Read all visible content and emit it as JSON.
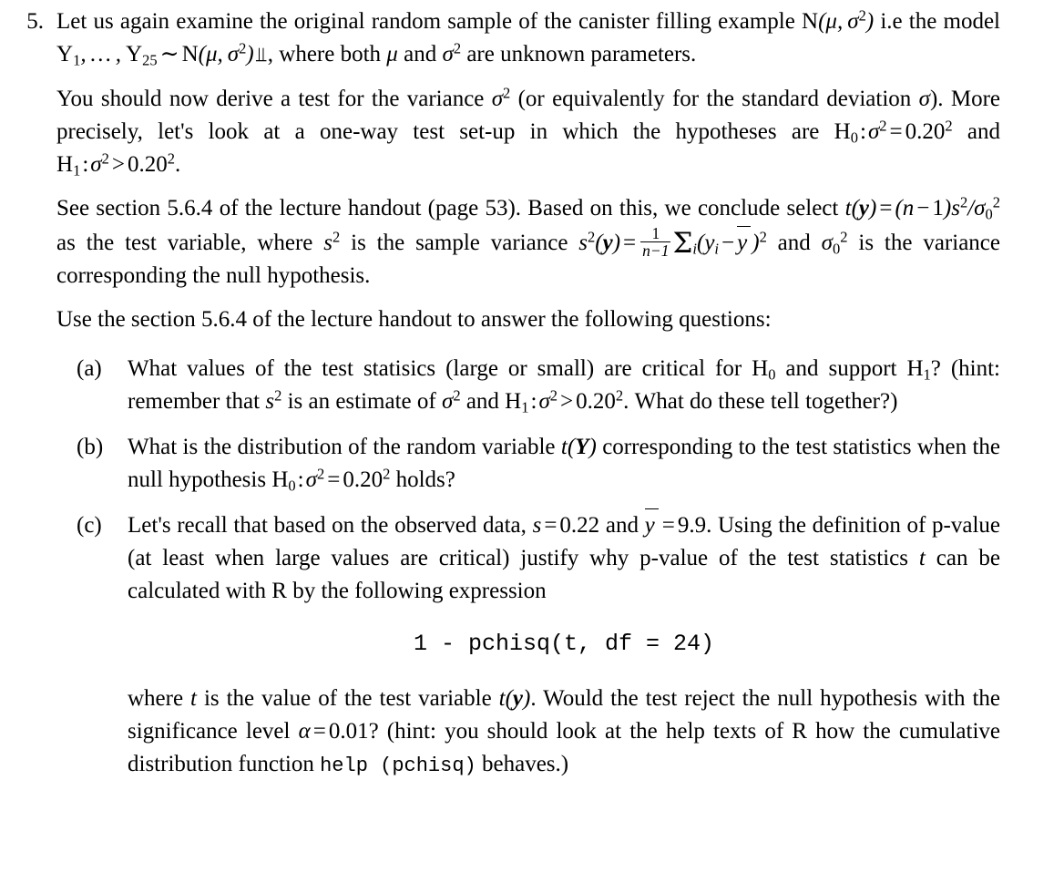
{
  "document": {
    "type": "exercise",
    "problem_number": "5.",
    "sub_labels": [
      "(a)",
      "(b)",
      "(c)"
    ]
  },
  "problem": {
    "intro": {
      "text_1": "Let us again examine the original random sample of the canister filling example ",
      "math_model_1": "N(μ, σ²)",
      "text_2": " i.e the model ",
      "math_model_2": "Y₁, …, Y₂₅ ~ N(μ, σ²) ⫫",
      "text_3": ", where both ",
      "math_mu": "μ",
      "text_4": " and ",
      "math_sigma2": "σ²",
      "text_5": " are unknown parameters."
    },
    "paragraph_2": {
      "text_1": "You should now derive a test for the variance ",
      "math_sigma2": "σ²",
      "text_2": " (or equivalently for the standard deviation ",
      "math_sigma": "σ",
      "text_3": "). More precisely, let's look at a one-way test set-up in which the hypotheses are ",
      "math_h0": "H₀: σ² = 0.20²",
      "text_4": " and ",
      "math_h1": "H₁: σ² > 0.20²",
      "text_5": "."
    },
    "paragraph_3": {
      "text_1": "See section 5.6.4 of the lecture handout (page 53).  Based on this, we conclude select ",
      "math_t": "t(y) = (n − 1)s²/σ₀²",
      "text_2": " as the test variable, where ",
      "math_s2": "s²",
      "text_3": " is the sample variance ",
      "math_s2_formula": "s²(y) = 1/(n−1) Σᵢ(yᵢ − ȳ)²",
      "text_4": " and ",
      "math_sigma0": "σ₀²",
      "text_5": " is the variance corresponding the null hypothesis.",
      "section_ref": "5.6.4",
      "page_ref": "53"
    },
    "paragraph_4": {
      "text_1": "Use the section ",
      "section_ref": "5.6.4",
      "text_2": " of the lecture handout to answer the following questions:"
    }
  },
  "items": {
    "a": {
      "label": "(a)",
      "text_1": "What values of the test statisics (large or small) are critical for ",
      "math_h0": "H₀",
      "text_2": " and support ",
      "math_h1": "H₁",
      "text_3": "? (hint: remember that ",
      "math_s2": "s²",
      "text_4": " is an estimate of ",
      "math_sigma2": "σ²",
      "text_5": " and ",
      "math_h1_full": "H₁: σ² > 0.20²",
      "text_6": ". What do these tell together?)"
    },
    "b": {
      "label": "(b)",
      "text_1": "What is the distribution of the random variable ",
      "math_tY": "t(Y)",
      "text_2": " corresponding to the test statistics when the null hypothesis ",
      "math_h0_full": "H₀: σ² = 0.20²",
      "text_3": " holds?"
    },
    "c": {
      "label": "(c)",
      "text_1": "Let's recall that based on the observed data, ",
      "math_s": "s = 0.22",
      "text_2": " and ",
      "math_ybar": "ȳ = 9.9",
      "text_3": ". Using the definition of p-value (at least when large values are critical) justify why p-value of the test statistics ",
      "math_t": "t",
      "text_4": " can be calculated with R by the following expression",
      "s_value": "0.22",
      "ybar_value": "9.9",
      "code": "1 - pchisq(t, df = 24)",
      "df_value": "24",
      "after_1": "where ",
      "after_math_t": "t",
      "after_2": " is the value of the test variable ",
      "after_math_ty": "t(y)",
      "after_3": ".  Would the test reject the null hypothesis with the significance level ",
      "after_math_alpha": "α = 0.01",
      "after_4": "?  (hint: you should look at the help texts of R how the cumulative distribution function ",
      "after_code": "help (pchisq)",
      "after_5": " behaves.)",
      "alpha_value": "0.01"
    }
  }
}
